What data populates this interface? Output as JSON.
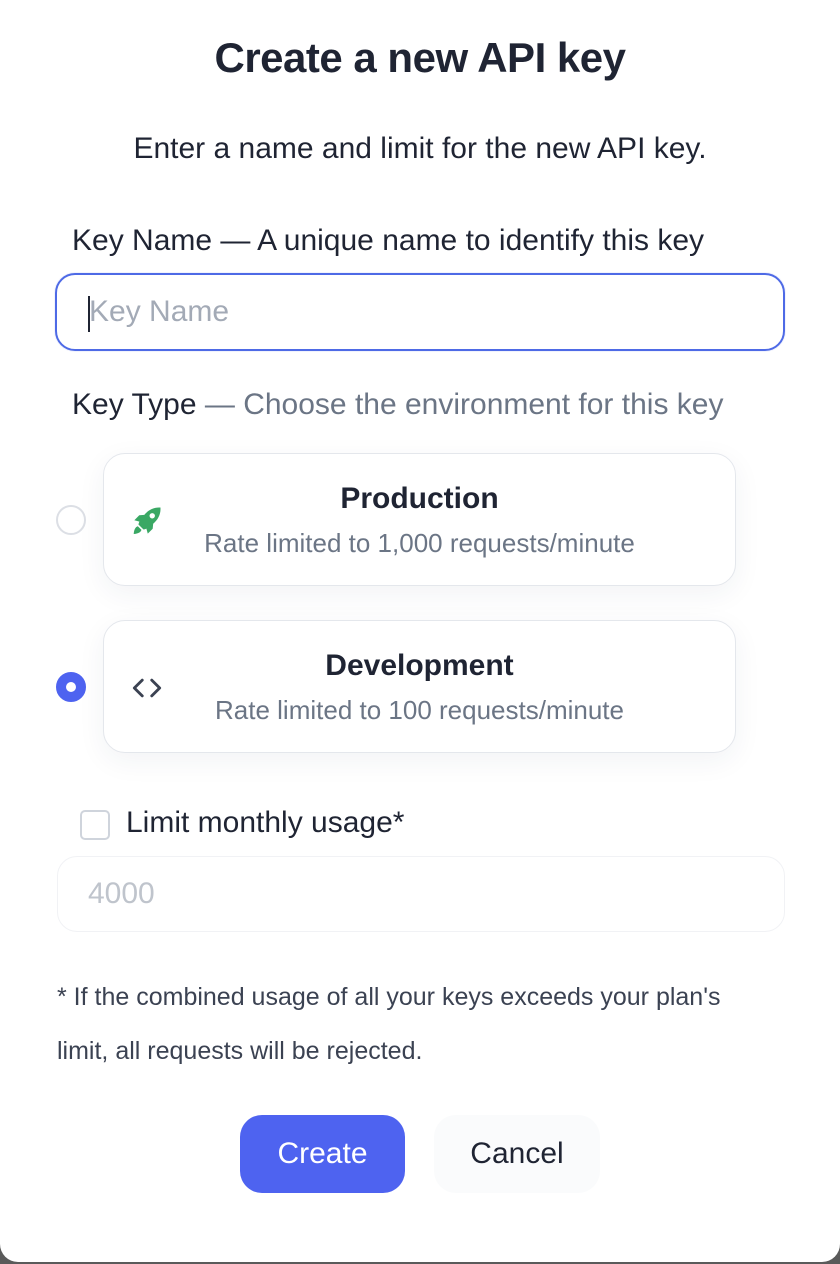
{
  "dialog": {
    "title": "Create a new API key",
    "subtitle": "Enter a name and limit for the new API key."
  },
  "key_name": {
    "label": "Key Name",
    "description": "— A unique name to identify this key",
    "value": "",
    "placeholder": "Key Name"
  },
  "key_type": {
    "label": "Key Type",
    "description": "— Choose the environment for this key",
    "selected": "Development",
    "options": [
      {
        "title": "Production",
        "subtitle": "Rate limited to 1,000 requests/minute",
        "icon": "rocket-icon",
        "selected": false,
        "icon_color": "#3aa864"
      },
      {
        "title": "Development",
        "subtitle": "Rate limited to 100 requests/minute",
        "icon": "code-icon",
        "selected": true,
        "icon_color": "#3b4252"
      }
    ]
  },
  "monthly_limit": {
    "checkbox_label": "Limit monthly usage*",
    "checked": false,
    "placeholder": "4000"
  },
  "footnote": "* If the combined usage of all your keys exceeds your plan's limit, all requests will be rejected.",
  "actions": {
    "create_label": "Create",
    "cancel_label": "Cancel"
  },
  "colors": {
    "accent": "#4e63f0",
    "focus_border": "#4e6ae6",
    "text_primary": "#1f2433",
    "text_muted": "#6b7585"
  }
}
